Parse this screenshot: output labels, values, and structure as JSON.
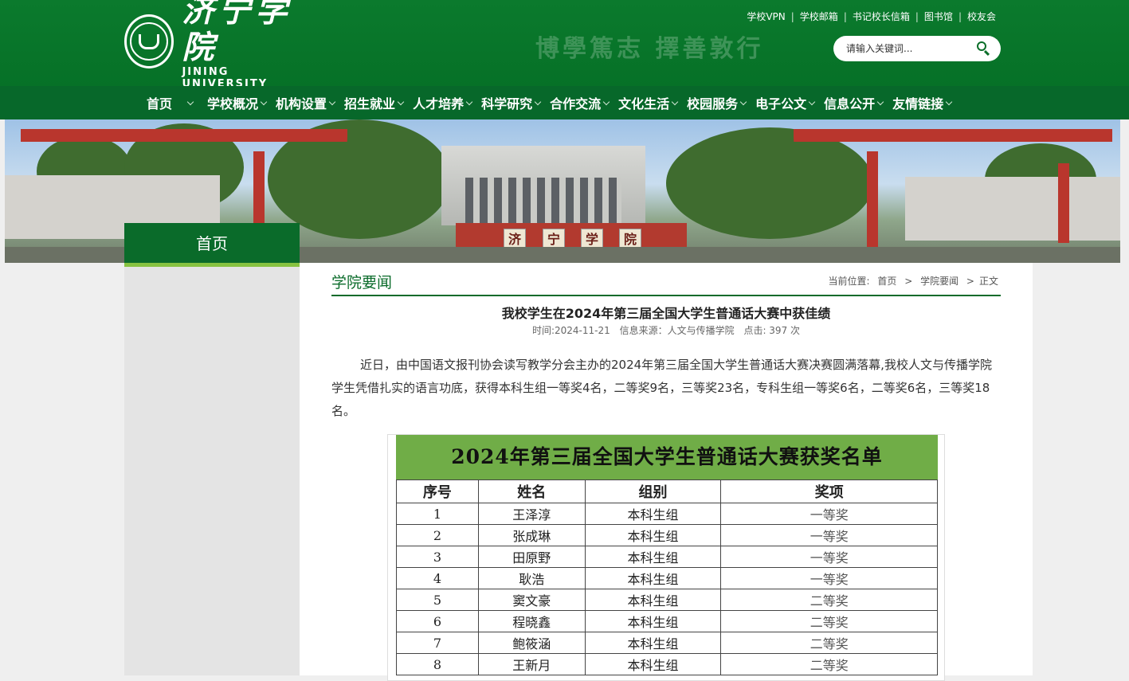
{
  "header": {
    "logo_cn": "济宁学院",
    "logo_en": "JINING UNIVERSITY",
    "motto": "博學篤志 擇善敦行",
    "top_links": [
      "学校VPN",
      "学校邮箱",
      "书记校长信箱",
      "图书馆",
      "校友会"
    ],
    "search_placeholder": "请输入关键词..."
  },
  "nav": {
    "items": [
      "首页",
      "学校概况",
      "机构设置",
      "招生就业",
      "人才培养",
      "科学研究",
      "合作交流",
      "文化生活",
      "校园服务",
      "电子公文",
      "信息公开",
      "友情链接"
    ]
  },
  "banner": {
    "plaque_chars": [
      "济",
      "宁",
      "学",
      "院"
    ]
  },
  "sidebar": {
    "title": "首页"
  },
  "section": {
    "title": "学院要闻",
    "breadcrumb_prefix": "当前位置:",
    "breadcrumb": [
      "首页",
      ">",
      "学院要闻",
      ">",
      "正文"
    ]
  },
  "article": {
    "title": "我校学生在2024年第三届全国大学生普通话大赛中获佳绩",
    "time": "时间:2024-11-21",
    "source": "信息来源：人文与传播学院",
    "views": "点击: 397 次",
    "body": "近日，由中国语文报刊协会读写教学分会主办的2024年第三届全国大学生普通话大赛决赛圆满落幕,我校人文与传播学院学生凭借扎实的语言功底，获得本科生组一等奖4名，二等奖9名，三等奖23名，专科生组一等奖6名，二等奖6名，三等奖18名。"
  },
  "award_table": {
    "heading": "2024年第三届全国大学生普通话大赛获奖名单",
    "columns": [
      "序号",
      "姓名",
      "组别",
      "奖项"
    ],
    "rows": [
      [
        "1",
        "王泽淳",
        "本科生组",
        "一等奖"
      ],
      [
        "2",
        "张成琳",
        "本科生组",
        "一等奖"
      ],
      [
        "3",
        "田原野",
        "本科生组",
        "一等奖"
      ],
      [
        "4",
        "耿浩",
        "本科生组",
        "一等奖"
      ],
      [
        "5",
        "窦文豪",
        "本科生组",
        "二等奖"
      ],
      [
        "6",
        "程晓鑫",
        "本科生组",
        "二等奖"
      ],
      [
        "7",
        "鲍筱涵",
        "本科生组",
        "二等奖"
      ],
      [
        "8",
        "王新月",
        "本科生组",
        "二等奖"
      ]
    ]
  },
  "colors": {
    "brand_green": "#0a6b2a",
    "accent_green": "#87c341",
    "table_head_green": "#70ad47"
  }
}
